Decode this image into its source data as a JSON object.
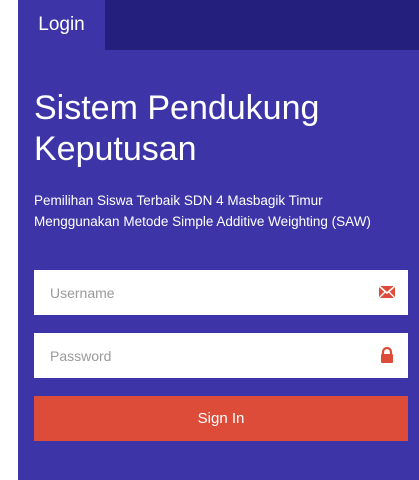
{
  "tabs": {
    "active_label": "Login"
  },
  "header": {
    "title": "Sistem Pendukung Keputusan",
    "subtitle": "Pemilihan Siswa Terbaik SDN 4 Masbagik Timur Menggunakan Metode Simple Additive Weighting (SAW)"
  },
  "form": {
    "username": {
      "value": "",
      "placeholder": "Username",
      "icon": "envelope-icon"
    },
    "password": {
      "value": "",
      "placeholder": "Password",
      "icon": "lock-icon"
    },
    "submit_label": "Sign In"
  },
  "colors": {
    "panel": "#3d34a8",
    "tabbar": "#241f7c",
    "accent": "#dd4b39"
  }
}
